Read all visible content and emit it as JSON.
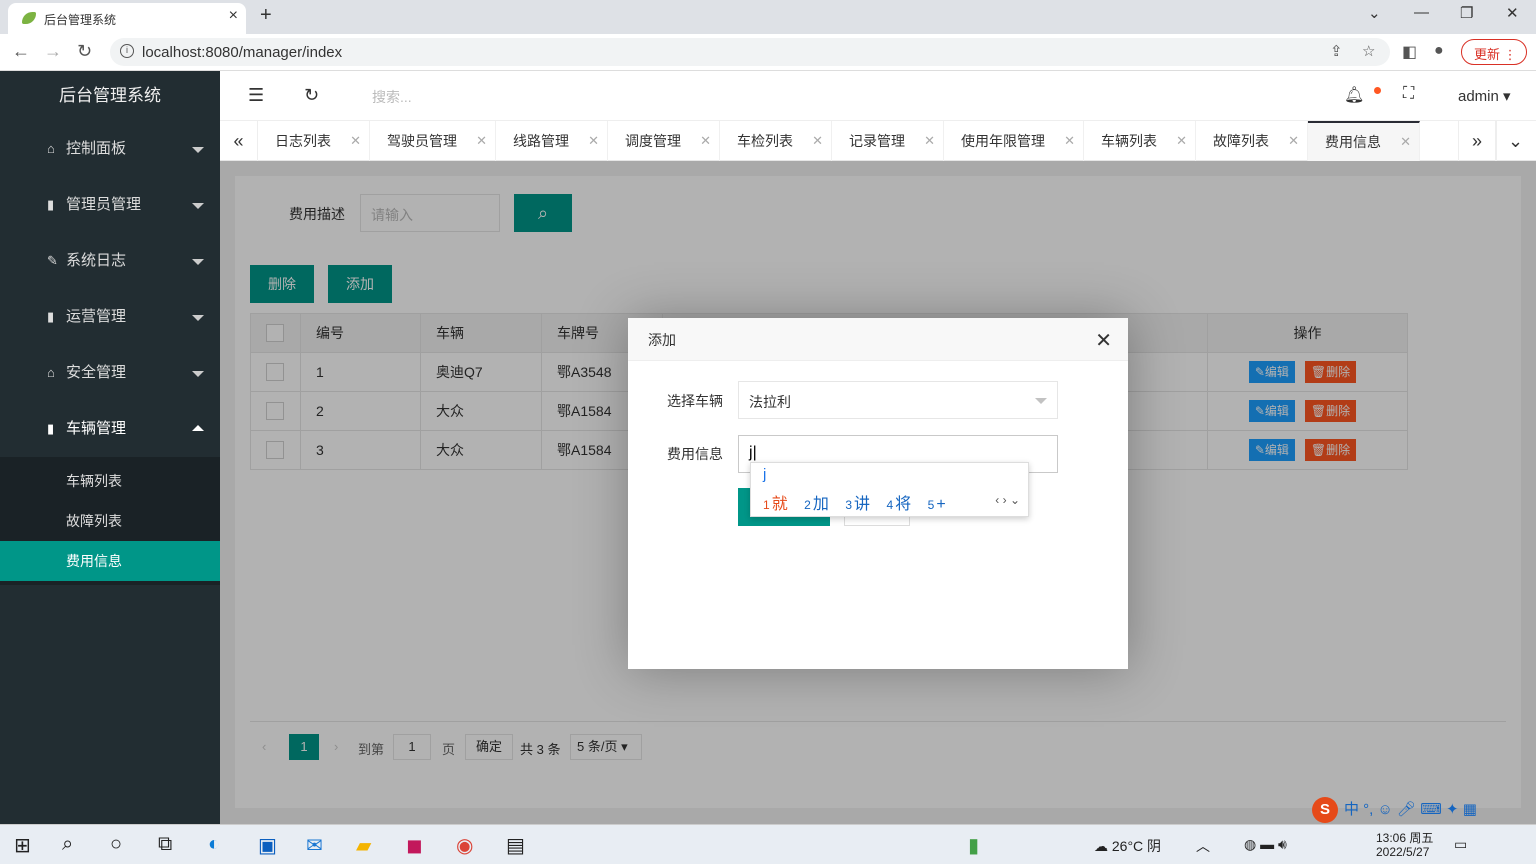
{
  "browser": {
    "tab_title": "后台管理系统",
    "url": "localhost:8080/manager/index",
    "update_label": "更新"
  },
  "sidebar": {
    "brand": "后台管理系统",
    "items": [
      {
        "label": "控制面板",
        "icon": "home-icon"
      },
      {
        "label": "管理员管理",
        "icon": "book-icon"
      },
      {
        "label": "系统日志",
        "icon": "pencil-icon"
      },
      {
        "label": "运营管理",
        "icon": "book-icon"
      },
      {
        "label": "安全管理",
        "icon": "home-icon"
      },
      {
        "label": "车辆管理",
        "icon": "book-icon"
      }
    ],
    "subitems": [
      "车辆列表",
      "故障列表",
      "费用信息"
    ]
  },
  "header": {
    "search_placeholder": "搜索...",
    "user": "admin"
  },
  "page_tabs": [
    "日志列表",
    "驾驶员管理",
    "线路管理",
    "调度管理",
    "车检列表",
    "记录管理",
    "使用年限管理",
    "车辆列表",
    "故障列表",
    "费用信息"
  ],
  "filter": {
    "label": "费用描述",
    "placeholder": "请输入"
  },
  "actions": {
    "delete": "删除",
    "add": "添加"
  },
  "table": {
    "headers": [
      "编号",
      "车辆",
      "车牌号",
      "操作"
    ],
    "rows": [
      {
        "id": "1",
        "car": "奥迪Q7",
        "plate": "鄂A3548"
      },
      {
        "id": "2",
        "car": "大众",
        "plate": "鄂A1584"
      },
      {
        "id": "3",
        "car": "大众",
        "plate": "鄂A1584"
      }
    ],
    "edit_label": "编辑",
    "delete_label": "删除"
  },
  "pager": {
    "current": "1",
    "goto_label": "到第",
    "goto_value": "1",
    "page_unit": "页",
    "confirm": "确定",
    "total": "共 3 条",
    "page_size": "5 条/页"
  },
  "dialog": {
    "title": "添加",
    "vehicle_label": "选择车辆",
    "vehicle_value": "法拉利",
    "fee_label": "费用信息",
    "fee_value": "j"
  },
  "ime": {
    "pinyin": "j",
    "candidates": [
      {
        "n": "1",
        "text": "就"
      },
      {
        "n": "2",
        "text": "加"
      },
      {
        "n": "3",
        "text": "讲"
      },
      {
        "n": "4",
        "text": "将"
      },
      {
        "n": "5",
        "text": "+"
      }
    ],
    "ime_mode": "中"
  },
  "taskbar": {
    "weather": "26°C 阴",
    "time": "13:06 周五",
    "date": "2022/5/27"
  },
  "colors": {
    "accent": "#009688",
    "sidebar_bg": "#222d32",
    "edit": "#1e9fff",
    "danger": "#ff5722"
  }
}
